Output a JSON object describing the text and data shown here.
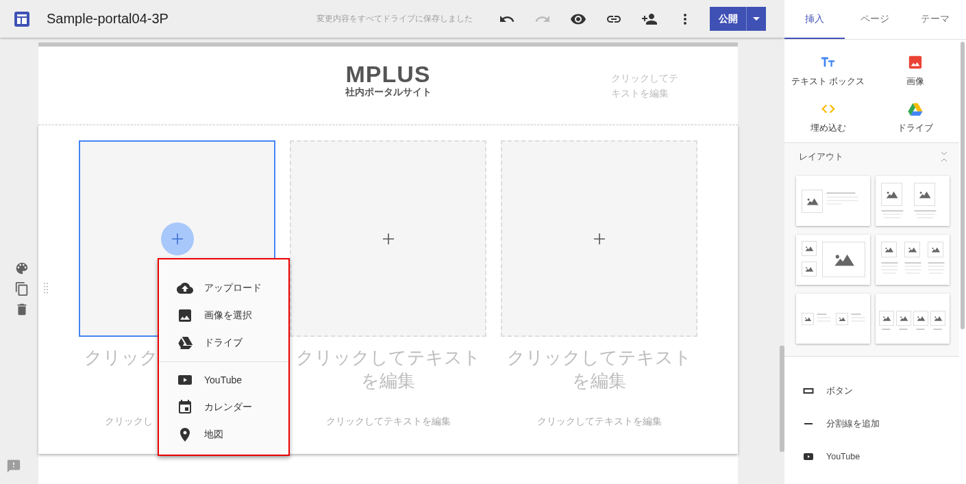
{
  "app_bar": {
    "title": "Sample-portal04-3P",
    "save_status": "変更内容をすべてドライブに保存しました",
    "toolbar": [
      {
        "kind": "undo",
        "disabled": false
      },
      {
        "kind": "redo",
        "disabled": true
      },
      {
        "kind": "preview",
        "disabled": false
      },
      {
        "kind": "link",
        "disabled": false
      },
      {
        "kind": "share",
        "disabled": false
      },
      {
        "kind": "more",
        "disabled": false
      }
    ],
    "publish_label": "公開"
  },
  "page": {
    "header": {
      "logo_title": "MPLUS",
      "logo_subtitle": "社内ポータルサイト",
      "text": "クリックしてテキストを編集"
    },
    "columns": [
      {
        "selected": true,
        "kind": "covered",
        "heading_lines": [
          "クリック"
        ],
        "caption": "クリックし"
      },
      {
        "selected": false,
        "kind": "open",
        "heading_lines": [
          "クリックしてテキスト",
          "を編集"
        ],
        "caption": "クリックしてテキストを編集"
      },
      {
        "selected": false,
        "kind": "open",
        "heading_lines": [
          "クリックしてテキスト",
          "を編集"
        ],
        "caption": "クリックしてテキストを編集"
      }
    ],
    "insert_menu": {
      "groups": [
        [
          {
            "kind": "upload",
            "label": "アップロード"
          },
          {
            "kind": "image",
            "label": "画像を選択"
          },
          {
            "kind": "drive",
            "label": "ドライブ"
          }
        ],
        [
          {
            "kind": "youtube",
            "label": "YouTube"
          },
          {
            "kind": "calendar",
            "label": "カレンダー"
          },
          {
            "kind": "map",
            "label": "地図"
          }
        ]
      ]
    }
  },
  "panel": {
    "tabs": [
      {
        "label": "挿入",
        "selected": true
      },
      {
        "label": "ページ",
        "selected": false
      },
      {
        "label": "テーマ",
        "selected": false
      }
    ],
    "insert_items": [
      {
        "kind": "text_box",
        "label": "テキスト ボックス"
      },
      {
        "kind": "image",
        "label": "画像"
      },
      {
        "kind": "embed",
        "label": "埋め込む"
      },
      {
        "kind": "drive",
        "label": "ドライブ"
      }
    ],
    "layout": {
      "title": "レイアウト",
      "expanded": true
    },
    "elements": [
      {
        "kind": "button",
        "label": "ボタン"
      },
      {
        "kind": "divider",
        "label": "分割線を追加"
      },
      {
        "kind": "youtube",
        "label": "YouTube"
      }
    ]
  }
}
